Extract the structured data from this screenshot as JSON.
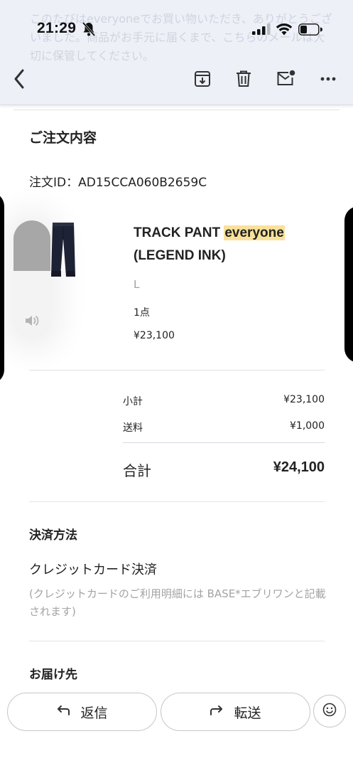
{
  "status": {
    "time": "21:29"
  },
  "ghost_text": "このたびはeveryoneでお買い物いただき、ありがとうございました。商品がお手元に届くまで、こちらのメールは大切に保管してください。",
  "order": {
    "heading": "ご注文内容",
    "order_id": "注文ID：AD15CCA060B2659C",
    "product": {
      "name_part1": "TRACK PANT ",
      "name_highlight": "everyone",
      "name_part2": "(LEGEND INK)",
      "size": "L",
      "qty": "1点",
      "price": "¥23,100"
    },
    "summary": {
      "subtotal_label": "小計",
      "subtotal_value": "¥23,100",
      "shipping_label": "送料",
      "shipping_value": "¥1,000",
      "total_label": "合計",
      "total_value": "¥24,100"
    }
  },
  "payment": {
    "heading": "決済方法",
    "method": "クレジットカード決済",
    "note": "(クレジットカードのご利用明細には BASE*エブリワンと記載されます)"
  },
  "delivery": {
    "heading": "お届け先"
  },
  "actions": {
    "reply": "返信",
    "forward": "転送"
  },
  "volume_level": 0.42,
  "colors": {
    "highlight": "#f9e19a",
    "header_bg": "#eef0f8"
  },
  "icons": [
    "back-icon",
    "archive-icon",
    "trash-icon",
    "mark-unread-icon",
    "more-icon",
    "reply-icon",
    "forward-icon",
    "emoji-icon",
    "speaker-icon"
  ]
}
